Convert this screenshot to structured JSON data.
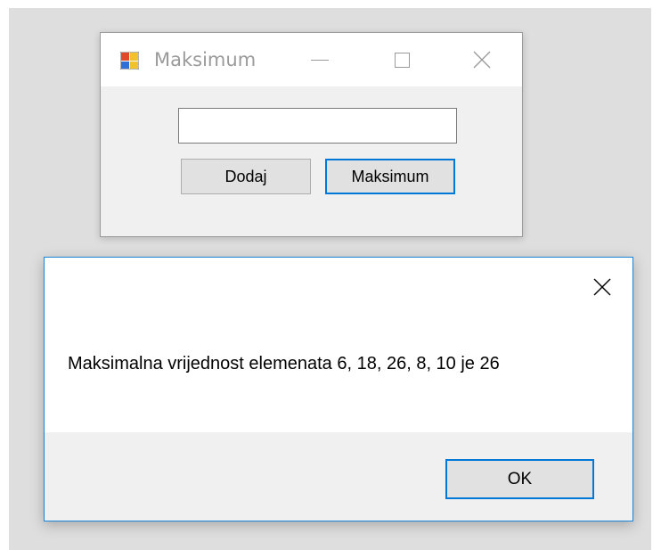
{
  "main_window": {
    "title": "Maksimum",
    "input_value": "",
    "add_button_label": "Dodaj",
    "max_button_label": "Maksimum"
  },
  "message_box": {
    "text": "Maksimalna vrijednost elemenata 6, 18, 26, 8, 10 je 26",
    "ok_button_label": "OK"
  },
  "icons": {
    "app": "windows-form-icon",
    "minimize": "minimize-icon",
    "maximize": "maximize-icon",
    "close": "close-icon"
  },
  "colors": {
    "accent": "#0078d7",
    "title_text": "#9a9a9a",
    "button_face": "#e1e1e1",
    "dialog_background": "#f0f0f0"
  }
}
